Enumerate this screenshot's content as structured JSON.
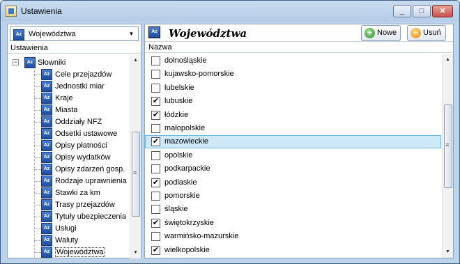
{
  "window": {
    "title": "Ustawienia"
  },
  "left": {
    "combo_value": "Województwa",
    "panel_label": "Ustawienia",
    "tree": {
      "root": "Słowniki",
      "items": [
        "Cele przejazdów",
        "Jednostki miar",
        "Kraje",
        "Miasta",
        "Oddziały NFZ",
        "Odsetki ustawowe",
        "Opisy płatności",
        "Opisy wydatków",
        "Opisy zdarzeń gosp.",
        "Rodzaje uprawnienia",
        "Stawki za km",
        "Trasy przejazdów",
        "Tytuły ubezpieczenia",
        "Usługi",
        "Waluty",
        "Województwa"
      ],
      "selected": "Województwa"
    }
  },
  "right": {
    "title": "Województwa",
    "buttons": {
      "new": "Nowe",
      "delete": "Usuń"
    },
    "column_header": "Nazwa",
    "rows": [
      {
        "name": "dolnośląskie",
        "checked": false
      },
      {
        "name": "kujawsko-pomorskie",
        "checked": false
      },
      {
        "name": "lubelskie",
        "checked": false
      },
      {
        "name": "lubuskie",
        "checked": true
      },
      {
        "name": "łódzkie",
        "checked": true
      },
      {
        "name": "małopolskie",
        "checked": false
      },
      {
        "name": "mazowieckie",
        "checked": true,
        "selected": true
      },
      {
        "name": "opolskie",
        "checked": false
      },
      {
        "name": "podkarpackie",
        "checked": false
      },
      {
        "name": "podlaskie",
        "checked": true
      },
      {
        "name": "pomorskie",
        "checked": false
      },
      {
        "name": "śląskie",
        "checked": false
      },
      {
        "name": "świętokrzyskie",
        "checked": true
      },
      {
        "name": "warmińsko-mazurskie",
        "checked": false
      },
      {
        "name": "wielkopolskie",
        "checked": true
      }
    ]
  },
  "icons": {
    "app": "settings-app-icon",
    "dictionary": "az-dictionary-icon",
    "new": "plus-circle-icon",
    "delete": "minus-circle-icon"
  },
  "colors": {
    "window_frame": "#bcd3ea",
    "selection": "#cde8f6",
    "selection_border": "#6fb6e0"
  }
}
